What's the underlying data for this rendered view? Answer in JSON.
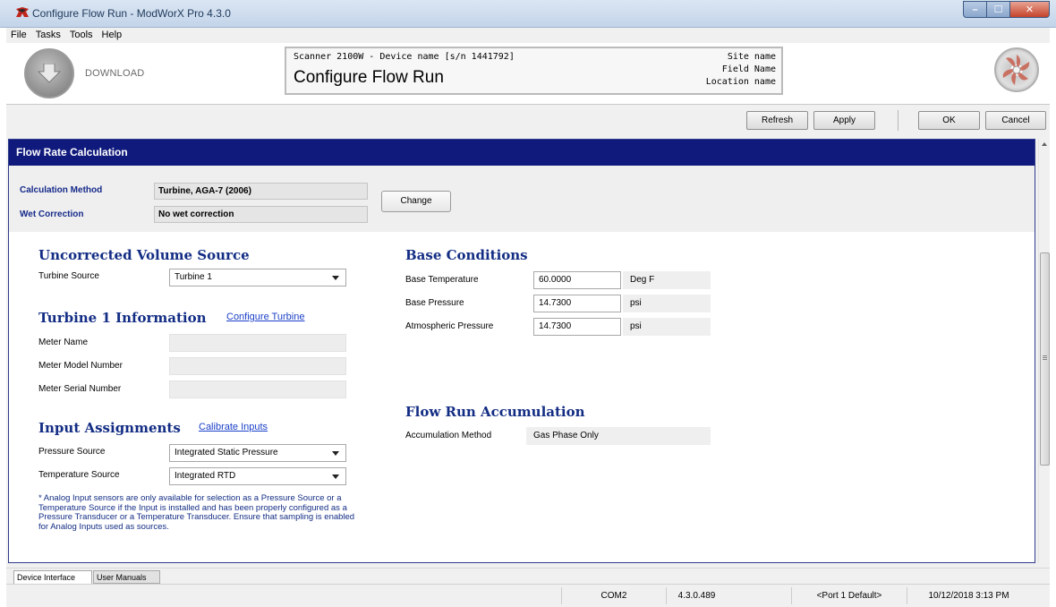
{
  "window": {
    "title": "Configure Flow Run - ModWorX Pro 4.3.0",
    "minimize": "–",
    "maximize": "☐",
    "close": "✕"
  },
  "menu": [
    "File",
    "Tasks",
    "Tools",
    "Help"
  ],
  "header": {
    "download_label": "DOWNLOAD",
    "device_line": "Scanner 2100W - Device name [s/n 1441792]",
    "page_title": "Configure Flow Run",
    "site_name": "Site name",
    "field_name": "Field Name",
    "location_name": "Location name"
  },
  "toolbar": {
    "refresh": "Refresh",
    "apply": "Apply",
    "ok": "OK",
    "cancel": "Cancel"
  },
  "section": {
    "title": "Flow Rate Calculation",
    "calc_method_label": "Calculation Method",
    "calc_method_value": "Turbine, AGA-7 (2006)",
    "wet_label": "Wet Correction",
    "wet_value": "No wet correction",
    "change_button": "Change"
  },
  "uncorrected": {
    "heading": "Uncorrected Volume Source",
    "turbine_source_label": "Turbine Source",
    "turbine_source_value": "Turbine 1"
  },
  "turbine_info": {
    "heading": "Turbine 1 Information",
    "configure_link": "Configure Turbine",
    "meter_name_label": "Meter Name",
    "meter_model_label": "Meter Model Number",
    "meter_serial_label": "Meter Serial Number"
  },
  "inputs": {
    "heading": "Input Assignments",
    "calibrate_link": "Calibrate Inputs",
    "pressure_label": "Pressure Source",
    "pressure_value": "Integrated Static Pressure",
    "temperature_label": "Temperature Source",
    "temperature_value": "Integrated RTD",
    "note": "* Analog Input sensors are only available for selection as a Pressure Source or a Temperature Source if the Input is installed and has been properly configured as a Pressure Transducer or a Temperature Transducer. Ensure that sampling is enabled for Analog Inputs used as sources."
  },
  "base_conditions": {
    "heading": "Base Conditions",
    "rows": [
      {
        "label": "Base Temperature",
        "value": "60.0000",
        "unit": "Deg F"
      },
      {
        "label": "Base Pressure",
        "value": "14.7300",
        "unit": "psi"
      },
      {
        "label": "Atmospheric Pressure",
        "value": "14.7300",
        "unit": "psi"
      }
    ]
  },
  "accumulation": {
    "heading": "Flow Run Accumulation",
    "method_label": "Accumulation Method",
    "method_value": "Gas Phase Only"
  },
  "tabs": [
    "Device Interface",
    "User Manuals"
  ],
  "status": {
    "port": "COM2",
    "version": "4.3.0.489",
    "port_default": "<Port 1 Default>",
    "datetime": "10/12/2018 3:13 PM"
  },
  "colors": {
    "section_header": "#101a7c",
    "heading_text": "#132d84",
    "link": "#1a3fc8"
  }
}
